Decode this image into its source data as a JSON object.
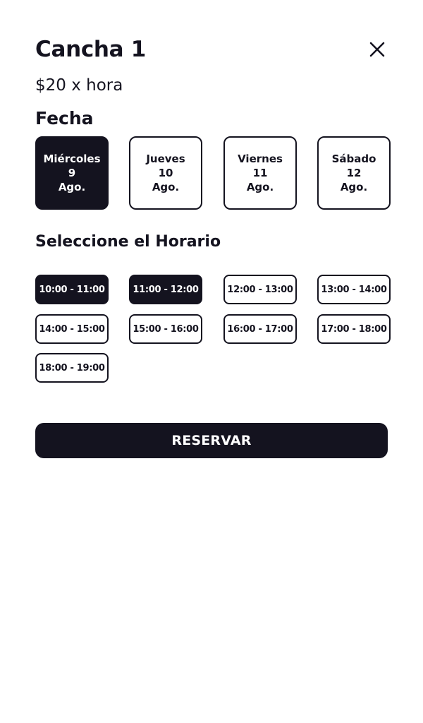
{
  "header": {
    "title": "Cancha 1",
    "close_icon": "close-icon"
  },
  "price": "$20 x hora",
  "date_section": {
    "title": "Fecha",
    "dates": [
      {
        "day": "Miércoles",
        "num": "9",
        "month": "Ago.",
        "selected": true
      },
      {
        "day": "Jueves",
        "num": "10",
        "month": "Ago.",
        "selected": false
      },
      {
        "day": "Viernes",
        "num": "11",
        "month": "Ago.",
        "selected": false
      },
      {
        "day": "Sábado",
        "num": "12",
        "month": "Ago.",
        "selected": false
      }
    ]
  },
  "time_section": {
    "title": "Seleccione el Horario",
    "slots": [
      {
        "label": "10:00 - 11:00",
        "selected": true
      },
      {
        "label": "11:00 - 12:00",
        "selected": true
      },
      {
        "label": "12:00 - 13:00",
        "selected": false
      },
      {
        "label": "13:00 - 14:00",
        "selected": false
      },
      {
        "label": "14:00 - 15:00",
        "selected": false
      },
      {
        "label": "15:00 - 16:00",
        "selected": false
      },
      {
        "label": "16:00 - 17:00",
        "selected": false
      },
      {
        "label": "17:00 - 18:00",
        "selected": false
      },
      {
        "label": "18:00 - 19:00",
        "selected": false
      }
    ]
  },
  "reserve_button": {
    "label": "RESERVAR"
  },
  "colors": {
    "primary": "#14131f",
    "background": "#ffffff"
  }
}
